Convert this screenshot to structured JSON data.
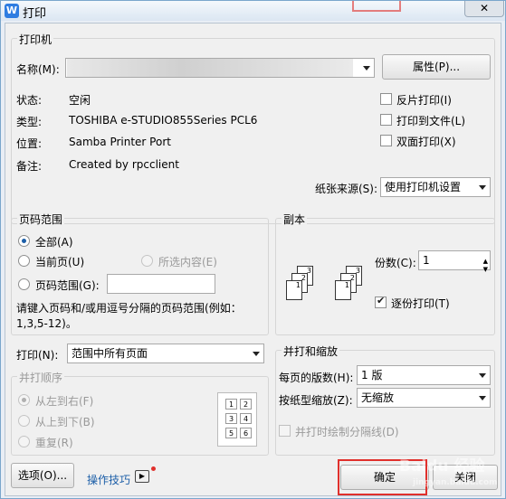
{
  "window": {
    "title": "打印",
    "app_icon_glyph": "W",
    "close_glyph": "✕"
  },
  "printer": {
    "group_title": "打印机",
    "name_label": "名称(M):",
    "properties_button": "属性(P)...",
    "status_label": "状态:",
    "status_value": "空闲",
    "type_label": "类型:",
    "type_value": "TOSHIBA e-STUDIO855Series PCL6",
    "location_label": "位置:",
    "location_value": "Samba Printer Port",
    "comment_label": "备注:",
    "comment_value": "Created by rpcclient",
    "reverse_print": "反片打印(I)",
    "print_to_file": "打印到文件(L)",
    "duplex": "双面打印(X)",
    "paper_source_label": "纸张来源(S):",
    "paper_source_value": "使用打印机设置"
  },
  "page_range": {
    "group_title": "页码范围",
    "all": "全部(A)",
    "current_page": "当前页(U)",
    "selection": "所选内容(E)",
    "pages": "页码范围(G):",
    "pages_value": "",
    "hint": "请键入页码和/或用逗号分隔的页码范围(例如：1,3,5-12)。"
  },
  "copies": {
    "group_title": "副本",
    "count_label": "份数(C):",
    "count_value": "1",
    "collate": "逐份打印(T)",
    "stack_a": [
      "3",
      "2",
      "1"
    ],
    "stack_b": [
      "3",
      "2",
      "1"
    ]
  },
  "print_what": {
    "label": "打印(N):",
    "value": "范围中所有页面"
  },
  "order": {
    "group_title": "并打顺序",
    "left_to_right": "从左到右(F)",
    "top_to_bottom": "从上到下(B)",
    "repeat": "重复(R)",
    "preview_numbers": [
      "1",
      "2",
      "3",
      "4",
      "5",
      "6"
    ]
  },
  "zoom": {
    "group_title": "并打和缩放",
    "pages_per_sheet_label": "每页的版数(H):",
    "pages_per_sheet_value": "1 版",
    "scale_label": "按纸型缩放(Z):",
    "scale_value": "无缩放",
    "draw_borders": "并打时绘制分隔线(D)"
  },
  "footer": {
    "options_button": "选项(O)...",
    "tips_link": "操作技巧",
    "ok_button": "确定",
    "close_button": "关闭"
  },
  "watermark": {
    "text": "Baidu 经验",
    "subtext": "jingyan.baidu.com"
  },
  "colors": {
    "highlight_red": "#e0302c",
    "link_blue": "#1d5fa8"
  }
}
